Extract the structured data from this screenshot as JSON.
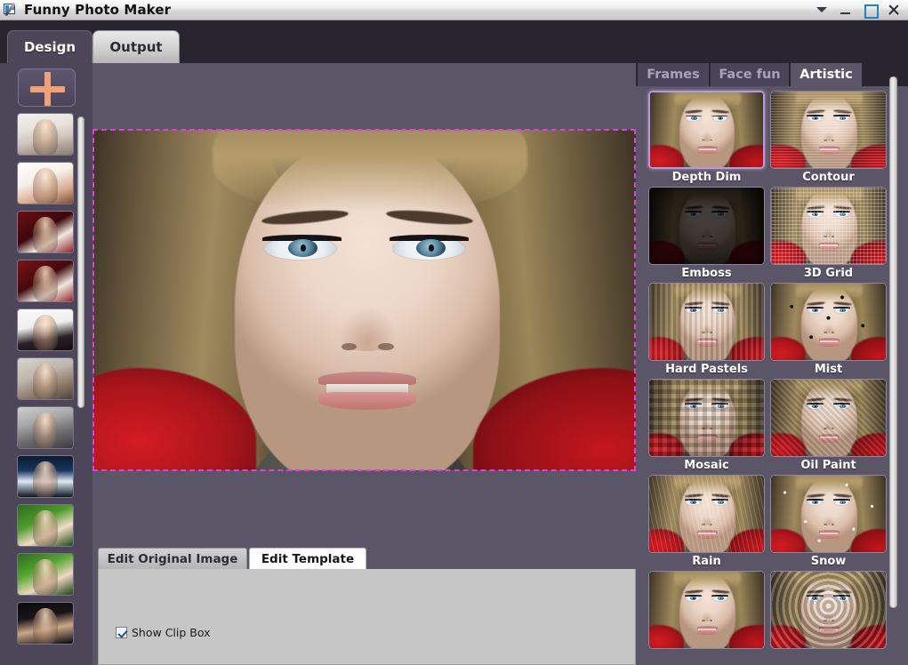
{
  "window": {
    "title": "Funny Photo Maker",
    "icon": "app-photo-pen-icon",
    "buttons": {
      "menu": "dropdown-chevron-icon",
      "minimize": "minimize-icon",
      "maximize": "maximize-icon",
      "close": "close-icon"
    }
  },
  "top_tabs": [
    {
      "label": "Design",
      "active": true
    },
    {
      "label": "Output",
      "active": false
    }
  ],
  "sidebar": {
    "add_button": {
      "icon": "plus-icon",
      "label": ""
    },
    "scrollbar": "vertical-scrollbar",
    "thumbnails": [
      {
        "name": "photo-thumbnail-1"
      },
      {
        "name": "photo-thumbnail-2"
      },
      {
        "name": "photo-thumbnail-3"
      },
      {
        "name": "photo-thumbnail-4"
      },
      {
        "name": "photo-thumbnail-5"
      },
      {
        "name": "photo-thumbnail-6"
      },
      {
        "name": "photo-thumbnail-7"
      },
      {
        "name": "photo-thumbnail-8"
      },
      {
        "name": "photo-thumbnail-9"
      },
      {
        "name": "photo-thumbnail-10"
      },
      {
        "name": "photo-thumbnail-11"
      }
    ]
  },
  "canvas": {
    "name": "editing-canvas",
    "clip_box_visible": true,
    "clip_box_color": "#e040d8"
  },
  "bottom_tabs": [
    {
      "label": "Edit Original Image",
      "active": false
    },
    {
      "label": "Edit Template",
      "active": true
    }
  ],
  "bottom_panel": {
    "checkbox": {
      "label": "Show Clip Box",
      "checked": true
    }
  },
  "right_panel": {
    "tabs": [
      {
        "label": "Frames",
        "active": false
      },
      {
        "label": "Face fun",
        "active": false
      },
      {
        "label": "Artistic",
        "active": true
      }
    ],
    "scrollbar": "vertical-scrollbar",
    "effects": [
      {
        "label": "Depth Dim",
        "selected": true,
        "style": "normal"
      },
      {
        "label": "Contour",
        "selected": false,
        "style": "contour"
      },
      {
        "label": "Emboss",
        "selected": false,
        "style": "dark"
      },
      {
        "label": "3D Grid",
        "selected": false,
        "style": "grid"
      },
      {
        "label": "Hard Pastels",
        "selected": false,
        "style": "pastel"
      },
      {
        "label": "Mist",
        "selected": false,
        "style": "scatter"
      },
      {
        "label": "Mosaic",
        "selected": false,
        "style": "mosaic"
      },
      {
        "label": "Oil Paint",
        "selected": false,
        "style": "oil"
      },
      {
        "label": "Rain",
        "selected": false,
        "style": "rain"
      },
      {
        "label": "Snow",
        "selected": false,
        "style": "snow"
      },
      {
        "label": "",
        "selected": false,
        "style": "normal"
      },
      {
        "label": "",
        "selected": false,
        "style": "swirl"
      }
    ]
  },
  "colors": {
    "app_background": "#5b5568",
    "chrome_dark": "#282430",
    "tab_active": "#4d4659",
    "accent_plus": "#f0a177",
    "selection": "#b79ad6",
    "clip_box": "#e040d8",
    "panel_gray": "#c6c6c6"
  }
}
